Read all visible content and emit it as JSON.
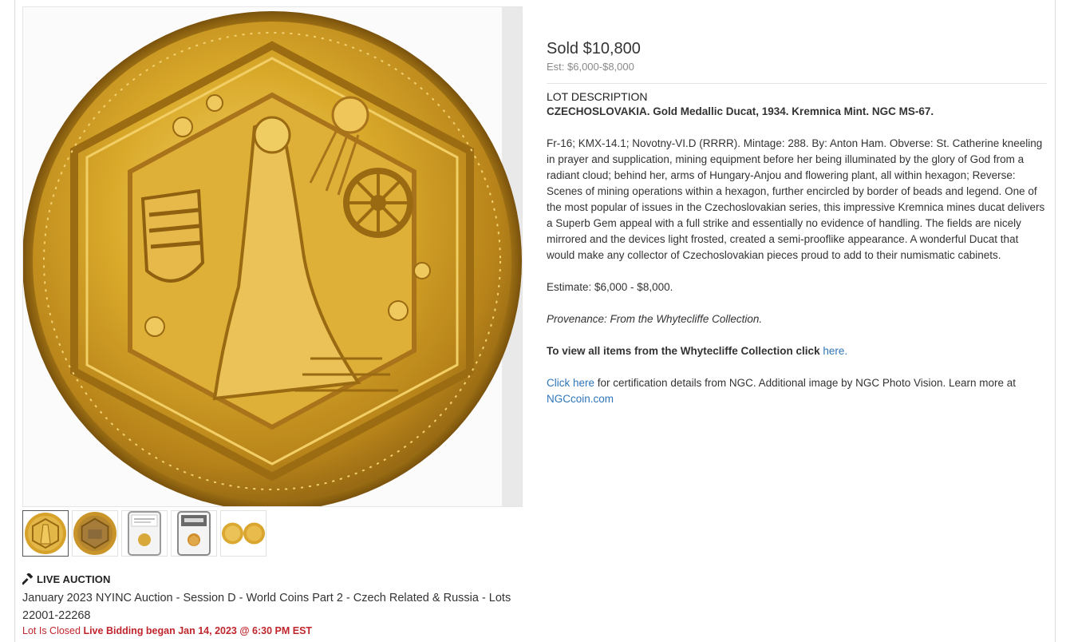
{
  "gallery": {
    "main_image_alt": "Gold medallic ducat obverse",
    "thumbnails": [
      {
        "name": "thumb-obverse",
        "active": true
      },
      {
        "name": "thumb-reverse",
        "active": false
      },
      {
        "name": "thumb-slab-front",
        "active": false
      },
      {
        "name": "thumb-slab-back",
        "active": false
      },
      {
        "name": "thumb-both-sides",
        "active": false
      }
    ]
  },
  "auction": {
    "type_label": "LIVE AUCTION",
    "session_title": "January 2023 NYINC Auction - Session D - World Coins Part 2 - Czech Related & Russia - Lots 22001-22268",
    "status_closed": "Lot Is Closed",
    "status_bidding": "Live Bidding began Jan 14, 2023 @ 6:30 PM EST"
  },
  "lot": {
    "sold_price": "Sold $10,800",
    "estimate_range": "Est: $6,000-$8,000",
    "description_label": "LOT DESCRIPTION",
    "headline": "CZECHOSLOVAKIA. Gold Medallic Ducat, 1934. Kremnica Mint. NGC MS-67.",
    "body": "Fr-16; KMX-14.1; Novotny-VI.D (RRRR). Mintage: 288. By: Anton Ham. Obverse: St. Catherine kneeling in prayer and supplication, mining equipment before her being illuminated by the glory of God from a radiant cloud; behind her, arms of Hungary-Anjou and flowering plant, all within hexagon; Reverse: Scenes of mining operations within a hexagon, further encircled by border of beads and legend. One of the most popular of issues in the Czechoslovakian series, this impressive Kremnica mines ducat delivers a Superb Gem appeal with a full strike and essentially no evidence of handling. The fields are nicely mirrored and the devices light frosted, created a semi-prooflike appearance. A wonderful Ducat that would make any collector of Czechoslovakian pieces proud to add to their numismatic cabinets.",
    "estimate": "Estimate: $6,000 - $8,000.",
    "provenance": "Provenance: From the Whytecliffe Collection.",
    "collection_text": "To view all items from the Whytecliffe Collection click ",
    "collection_link": "here.",
    "cert_link": "Click here",
    "cert_text": " for certification details from NGC. Additional image by NGC Photo Vision. Learn more at ",
    "ngc_link": "NGCcoin.com"
  },
  "colors": {
    "link": "#2f76b9",
    "closed_red": "#c0262d",
    "gold": "#d4a520"
  }
}
